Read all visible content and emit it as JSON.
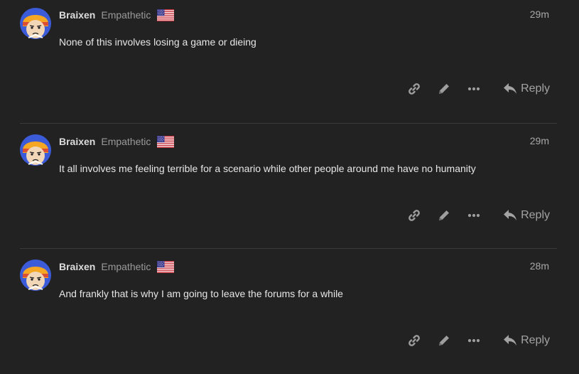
{
  "posts": [
    {
      "username": "Braixen",
      "user_title": "Empathetic",
      "flag_icon": "us-flag-icon",
      "time": "29m",
      "body": "None of this involves losing a game or dieing",
      "reply_label": "Reply"
    },
    {
      "username": "Braixen",
      "user_title": "Empathetic",
      "flag_icon": "us-flag-icon",
      "time": "29m",
      "body": "It all involves me feeling terrible for a scenario while other people around me have no humanity",
      "reply_label": "Reply"
    },
    {
      "username": "Braixen",
      "user_title": "Empathetic",
      "flag_icon": "us-flag-icon",
      "time": "28m",
      "body": "And frankly that is why I am going to leave the forums for a while",
      "reply_label": "Reply"
    }
  ],
  "icons": {
    "link": "link-icon",
    "edit": "pencil-icon",
    "more": "ellipsis-icon",
    "reply": "reply-arrow-icon"
  },
  "colors": {
    "background": "#222222",
    "divider": "#3a3a3a",
    "text": "#dddddd",
    "muted": "#9a9a9a",
    "avatar_hair": "#f5a623",
    "avatar_band": "#d94e35",
    "avatar_bg": "#3b5bd9"
  }
}
